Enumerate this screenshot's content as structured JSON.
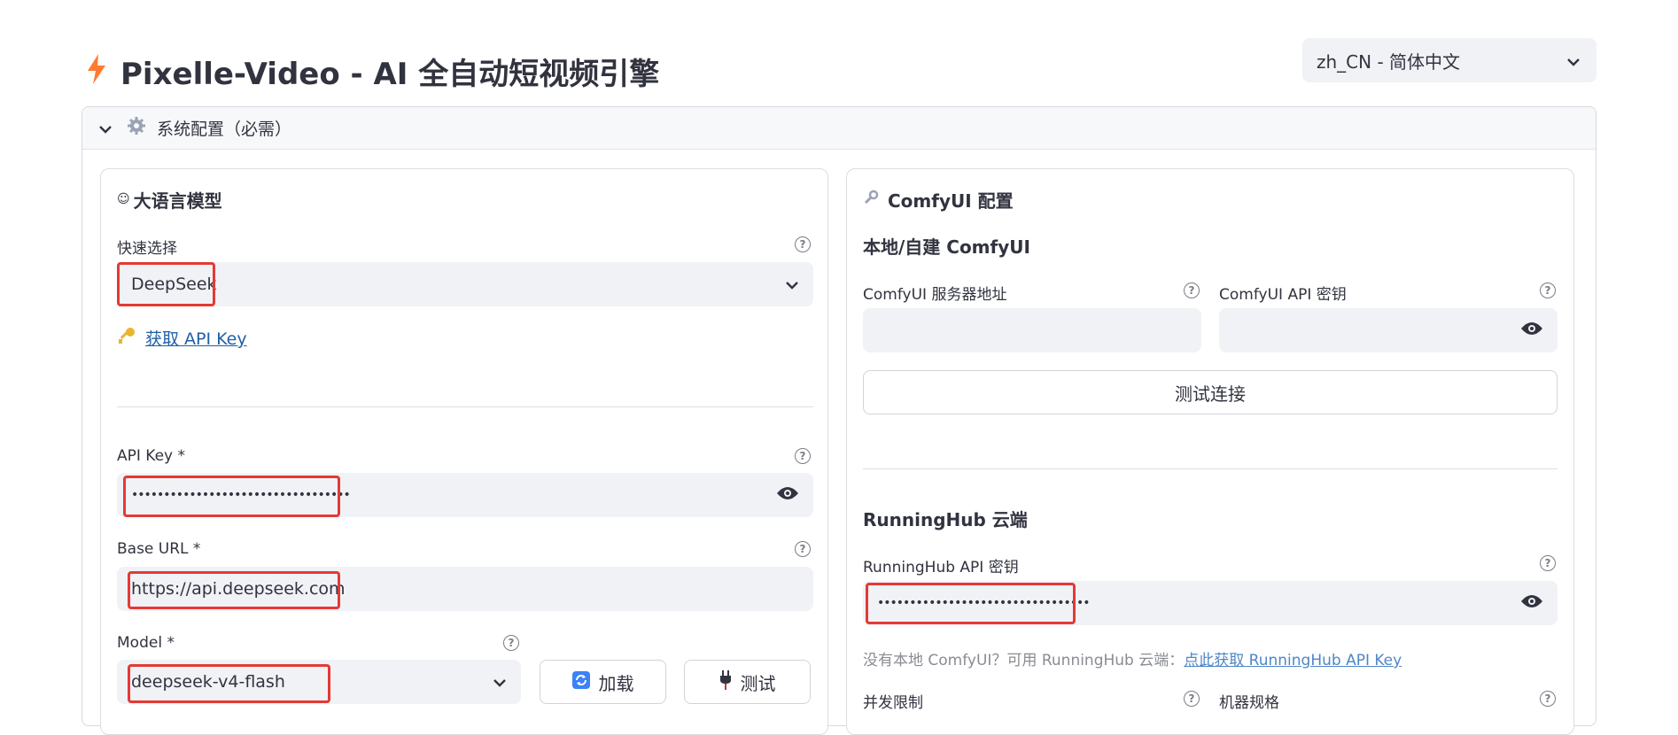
{
  "app": {
    "title": "Pixelle-Video - AI 全自动短视频引擎",
    "language": "zh_CN - 简体中文"
  },
  "expander": {
    "label": "系统配置（必需）"
  },
  "llm": {
    "title": "大语言模型",
    "quick_select_label": "快速选择",
    "quick_select_value": "DeepSeek",
    "get_key_link": "获取 API Key",
    "api_key_label": "API Key *",
    "api_key_value": "••••••••••••••••••••••••••••••••••",
    "base_url_label": "Base URL *",
    "base_url_value": "https://api.deepseek.com",
    "model_label": "Model *",
    "model_value": "deepseek-v4-flash",
    "load_button": "加载",
    "test_button": "测试"
  },
  "comfy": {
    "title": "ComfyUI 配置",
    "local_title": "本地/自建 ComfyUI",
    "server_label": "ComfyUI 服务器地址",
    "api_key_label": "ComfyUI API 密钥",
    "test_connection": "测试连接",
    "runninghub_title": "RunningHub 云端",
    "runninghub_key_label": "RunningHub API 密钥",
    "runninghub_key_value": "•••••••••••••••••••••••••••••••••",
    "hint_text": "没有本地 ComfyUI？可用 RunningHub 云端：",
    "hint_link": "点此获取 RunningHub API Key",
    "concurrency_label": "并发限制",
    "machine_label": "机器规格"
  },
  "icons": [
    "lightning-icon",
    "chevron-down-icon",
    "gear-icon",
    "robot-icon",
    "key-icon",
    "eye-icon",
    "wrench-icon",
    "refresh-icon",
    "plug-icon",
    "help-icon"
  ],
  "colors": {
    "highlight": "#e53935",
    "input_bg": "#f0f2f6",
    "brand": "#ff6b35",
    "link": "#1f5fa8"
  }
}
